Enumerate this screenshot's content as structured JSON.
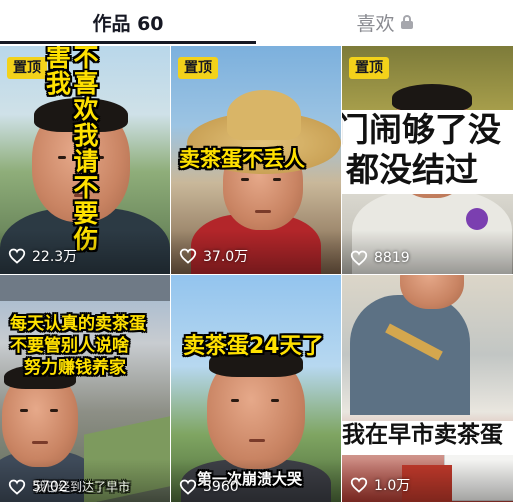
{
  "tabs": {
    "works_label": "作品 60",
    "likes_label": "喜欢"
  },
  "pinned_label": "置顶",
  "videos": [
    {
      "caption": "不喜欢我请不要伤害我",
      "likes": "22.3万",
      "pinned": true
    },
    {
      "caption": "卖茶蛋不丢人",
      "likes": "37.0万",
      "pinned": true
    },
    {
      "caption_lines": [
        "门闹够了没",
        "都没结过"
      ],
      "likes": "8819",
      "pinned": true
    },
    {
      "caption_lines": [
        "每天认真的卖茶蛋",
        "不要管别人说啥",
        "努力赚钱养家"
      ],
      "subcaption": "我已经到达了早市",
      "likes": "5702",
      "pinned": false
    },
    {
      "caption": "卖茶蛋24天了",
      "subcaption": "第一次崩溃大哭",
      "likes": "5960",
      "pinned": false
    },
    {
      "caption": "我在早市卖茶蛋",
      "likes": "1.0万",
      "pinned": false
    }
  ],
  "colors": {
    "pin_badge": "#f3d21a",
    "caption_yellow": "#ffe100",
    "tab_active": "#161823",
    "tab_inactive": "#8a8b91"
  },
  "icons": {
    "likes_tab": "lock-icon",
    "like_count": "heart-outline-icon"
  }
}
